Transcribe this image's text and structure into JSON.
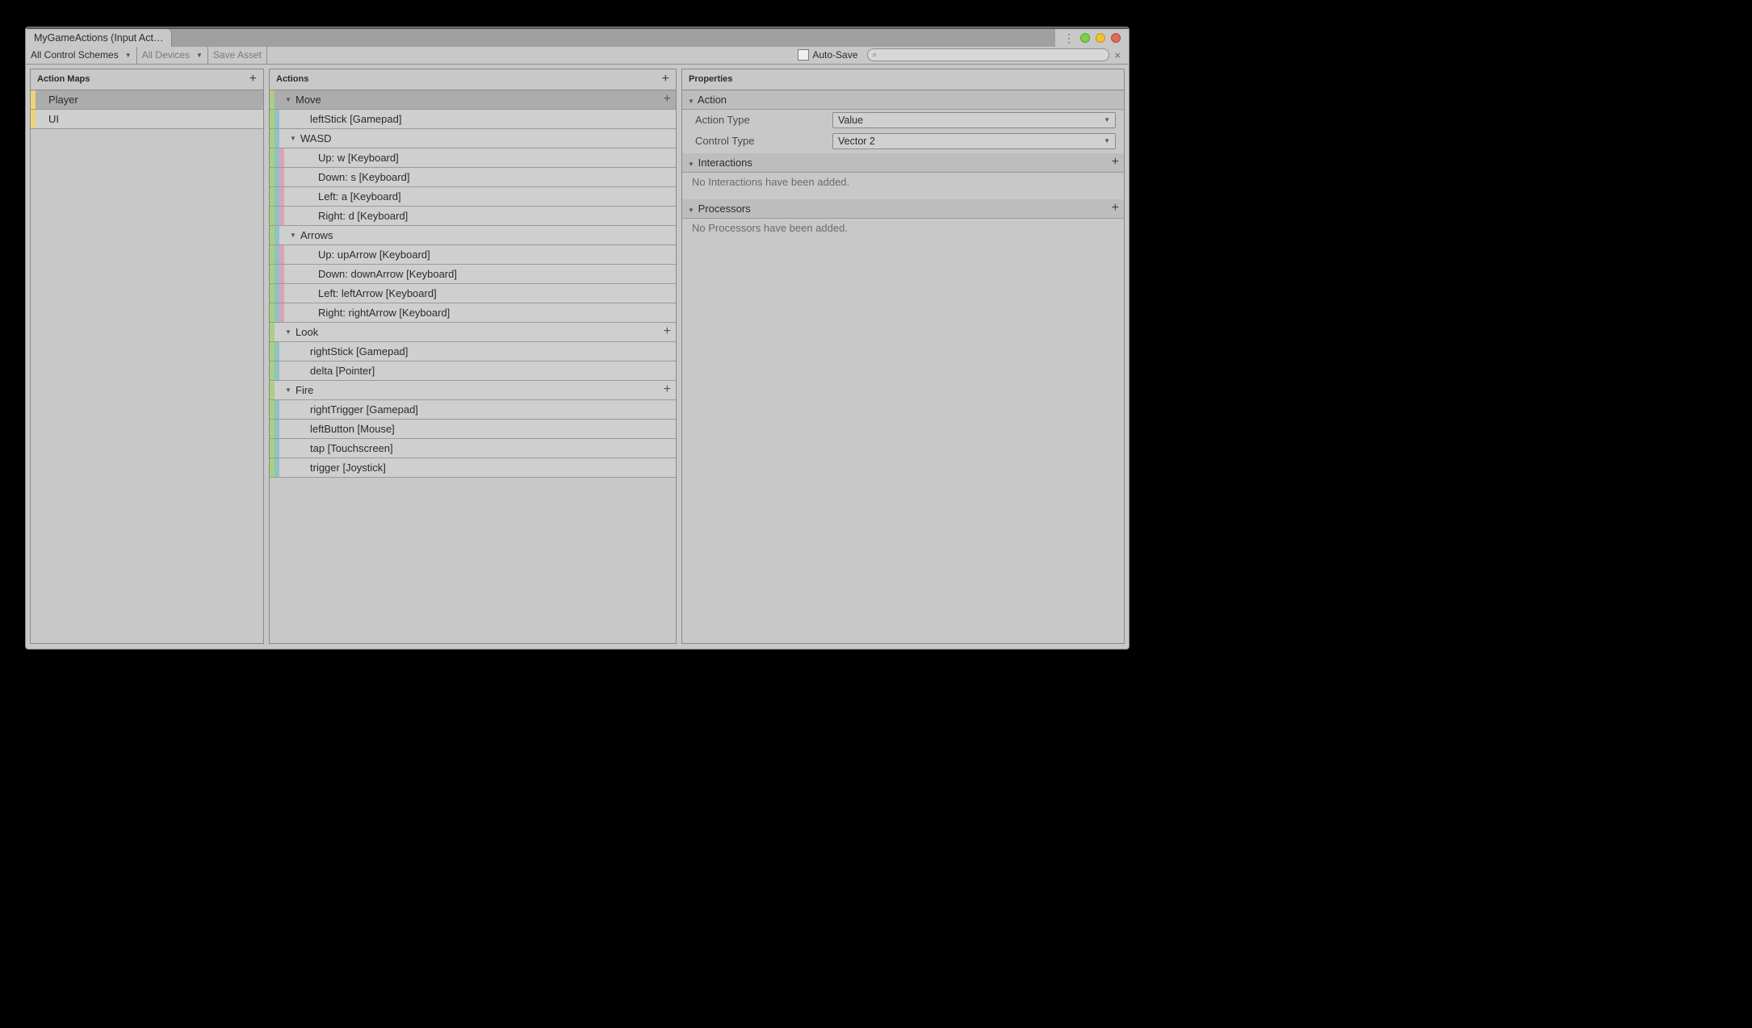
{
  "window": {
    "tab_title": "MyGameActions (Input Act…"
  },
  "toolbar": {
    "scheme_label": "All Control Schemes",
    "devices_label": "All Devices",
    "save_label": "Save Asset",
    "autosave_label": "Auto-Save",
    "search_placeholder": ""
  },
  "maps_panel": {
    "title": "Action Maps"
  },
  "maps": [
    {
      "name": "Player",
      "selected": true
    },
    {
      "name": "UI",
      "selected": false
    }
  ],
  "actions_panel": {
    "title": "Actions"
  },
  "actions_rows": [
    {
      "kind": "action",
      "label": "Move",
      "selected": true,
      "hasPlus": true
    },
    {
      "kind": "binding",
      "label": "leftStick [Gamepad]"
    },
    {
      "kind": "composite",
      "label": "WASD"
    },
    {
      "kind": "part",
      "label": "Up: w [Keyboard]"
    },
    {
      "kind": "part",
      "label": "Down: s [Keyboard]"
    },
    {
      "kind": "part",
      "label": "Left: a [Keyboard]"
    },
    {
      "kind": "part",
      "label": "Right: d [Keyboard]"
    },
    {
      "kind": "composite",
      "label": "Arrows"
    },
    {
      "kind": "part",
      "label": "Up: upArrow [Keyboard]"
    },
    {
      "kind": "part",
      "label": "Down: downArrow [Keyboard]"
    },
    {
      "kind": "part",
      "label": "Left: leftArrow [Keyboard]"
    },
    {
      "kind": "part",
      "label": "Right: rightArrow [Keyboard]"
    },
    {
      "kind": "action",
      "label": "Look",
      "hasPlus": true
    },
    {
      "kind": "binding",
      "label": "rightStick [Gamepad]"
    },
    {
      "kind": "binding",
      "label": "delta [Pointer]"
    },
    {
      "kind": "action",
      "label": "Fire",
      "hasPlus": true
    },
    {
      "kind": "binding",
      "label": "rightTrigger [Gamepad]"
    },
    {
      "kind": "binding",
      "label": "leftButton [Mouse]"
    },
    {
      "kind": "binding",
      "label": "tap [Touchscreen]"
    },
    {
      "kind": "binding",
      "label": "trigger [Joystick]"
    }
  ],
  "properties": {
    "title": "Properties",
    "action_section": "Action",
    "action_type_label": "Action Type",
    "action_type_value": "Value",
    "control_type_label": "Control Type",
    "control_type_value": "Vector 2",
    "interactions_title": "Interactions",
    "interactions_empty": "No Interactions have been added.",
    "processors_title": "Processors",
    "processors_empty": "No Processors have been added."
  }
}
